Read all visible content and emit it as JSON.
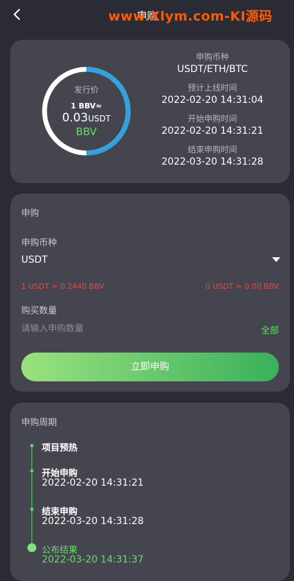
{
  "header": {
    "title": "申购",
    "back_icon": "chevron-left-icon"
  },
  "watermark": "www.Xlym.com-KI源码",
  "summary": {
    "ring_label": "发行价",
    "rate_line": "1 BBV≈",
    "price": "0.03",
    "price_unit": "USDT",
    "coin": "BBV",
    "ring_colors": {
      "track": "#ffffff",
      "arc": "#2ea3e0"
    },
    "info": [
      {
        "label": "申购币种",
        "value": "USDT/ETH/BTC"
      },
      {
        "label": "预计上线时间",
        "value": "2022-02-20 14:31:04"
      },
      {
        "label": "开始申购时间",
        "value": "2022-02-20 14:31:21"
      },
      {
        "label": "结束申购时间",
        "value": "2022-03-20 14:31:28"
      }
    ]
  },
  "purchase": {
    "title": "申购",
    "currency_label": "申购币种",
    "currency_value": "USDT",
    "rate_left": "1 USDT ≈ 0.2440 BBV",
    "rate_right": "0 USDT ≈ 0.00 BBV",
    "qty_label": "购买数量",
    "qty_placeholder": "请输入申购数量",
    "all_label": "全部",
    "submit_label": "立即申购"
  },
  "cycle": {
    "title": "申购周期",
    "steps": [
      {
        "title": "项目预热",
        "date": ""
      },
      {
        "title": "开始申购",
        "date": "2022-02-20 14:31:21"
      },
      {
        "title": "结束申购",
        "date": "2022-03-20 14:31:28"
      },
      {
        "title": "公布结果",
        "date": "2022-03-20 14:31:37"
      }
    ]
  },
  "colors": {
    "accent_green": "#6bdc6b",
    "danger_red": "#e04b4b",
    "ring_blue": "#2ea3e0"
  }
}
